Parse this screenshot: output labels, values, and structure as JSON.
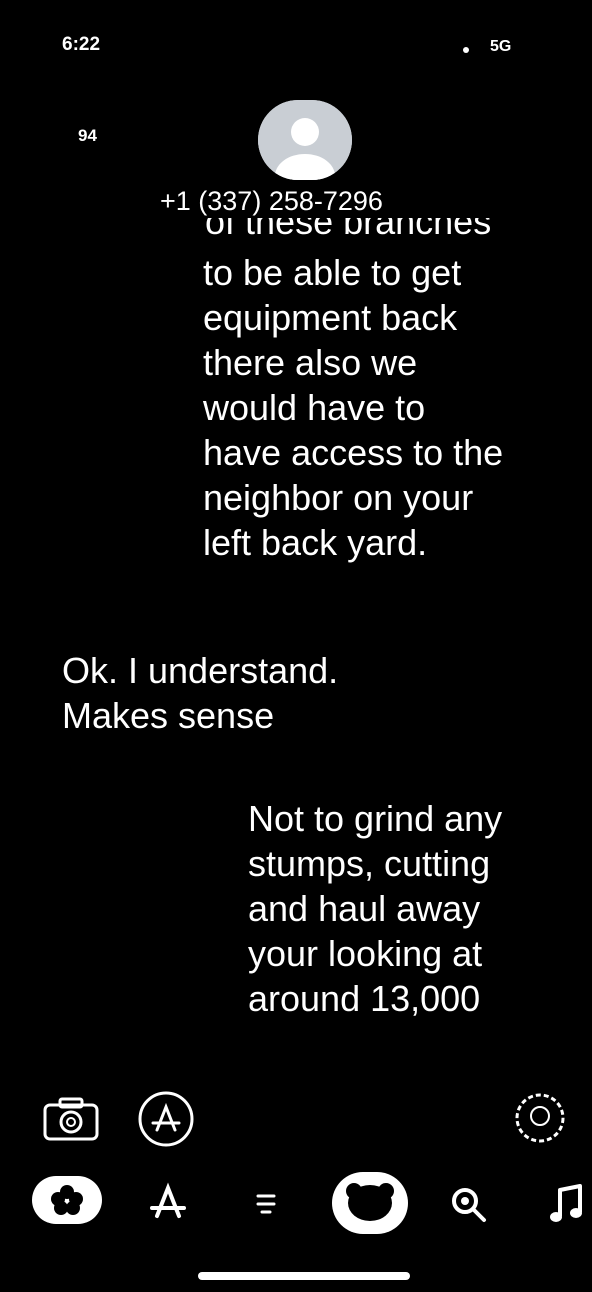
{
  "status": {
    "time": "6:22",
    "network": "5G"
  },
  "header": {
    "badge": "94",
    "contact": "+1 (337) 258-7296"
  },
  "messages": [
    {
      "direction": "outgoing",
      "partial_first_line": "of these branches",
      "lines": [
        "to be able to get",
        "equipment back",
        "there also we",
        "would have to",
        "have access to the",
        "neighbor on your",
        "left back yard."
      ]
    },
    {
      "direction": "incoming",
      "lines": [
        "Ok. I understand.",
        "Makes sense"
      ]
    },
    {
      "direction": "outgoing",
      "lines": [
        "Not to grind any",
        "stumps, cutting",
        "and haul away",
        "your looking at",
        "around 13,000"
      ]
    }
  ],
  "app_drawer": {
    "row1": [
      "camera-icon",
      "appstore-icon",
      "memoji-icon"
    ],
    "row2": [
      "photos-icon",
      "appstore-icon",
      "audio-icon",
      "memoji-icon",
      "search-images-icon",
      "music-icon"
    ]
  }
}
